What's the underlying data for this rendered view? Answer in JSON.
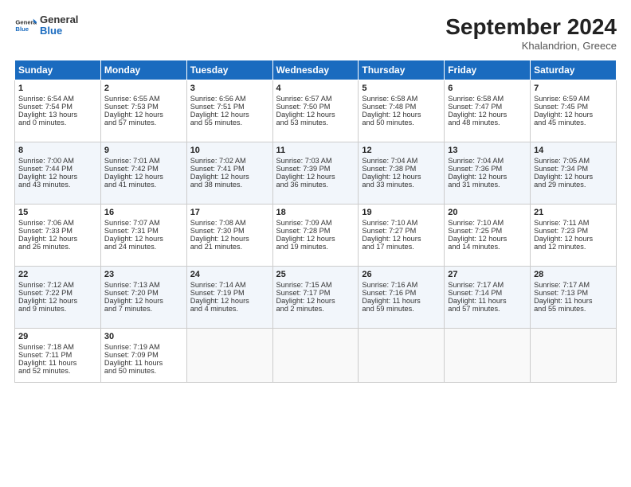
{
  "header": {
    "logo_general": "General",
    "logo_blue": "Blue",
    "month_title": "September 2024",
    "location": "Khalandrion, Greece"
  },
  "weekdays": [
    "Sunday",
    "Monday",
    "Tuesday",
    "Wednesday",
    "Thursday",
    "Friday",
    "Saturday"
  ],
  "rows": [
    [
      {
        "day": "1",
        "lines": [
          "Sunrise: 6:54 AM",
          "Sunset: 7:54 PM",
          "Daylight: 13 hours",
          "and 0 minutes."
        ]
      },
      {
        "day": "2",
        "lines": [
          "Sunrise: 6:55 AM",
          "Sunset: 7:53 PM",
          "Daylight: 12 hours",
          "and 57 minutes."
        ]
      },
      {
        "day": "3",
        "lines": [
          "Sunrise: 6:56 AM",
          "Sunset: 7:51 PM",
          "Daylight: 12 hours",
          "and 55 minutes."
        ]
      },
      {
        "day": "4",
        "lines": [
          "Sunrise: 6:57 AM",
          "Sunset: 7:50 PM",
          "Daylight: 12 hours",
          "and 53 minutes."
        ]
      },
      {
        "day": "5",
        "lines": [
          "Sunrise: 6:58 AM",
          "Sunset: 7:48 PM",
          "Daylight: 12 hours",
          "and 50 minutes."
        ]
      },
      {
        "day": "6",
        "lines": [
          "Sunrise: 6:58 AM",
          "Sunset: 7:47 PM",
          "Daylight: 12 hours",
          "and 48 minutes."
        ]
      },
      {
        "day": "7",
        "lines": [
          "Sunrise: 6:59 AM",
          "Sunset: 7:45 PM",
          "Daylight: 12 hours",
          "and 45 minutes."
        ]
      }
    ],
    [
      {
        "day": "8",
        "lines": [
          "Sunrise: 7:00 AM",
          "Sunset: 7:44 PM",
          "Daylight: 12 hours",
          "and 43 minutes."
        ]
      },
      {
        "day": "9",
        "lines": [
          "Sunrise: 7:01 AM",
          "Sunset: 7:42 PM",
          "Daylight: 12 hours",
          "and 41 minutes."
        ]
      },
      {
        "day": "10",
        "lines": [
          "Sunrise: 7:02 AM",
          "Sunset: 7:41 PM",
          "Daylight: 12 hours",
          "and 38 minutes."
        ]
      },
      {
        "day": "11",
        "lines": [
          "Sunrise: 7:03 AM",
          "Sunset: 7:39 PM",
          "Daylight: 12 hours",
          "and 36 minutes."
        ]
      },
      {
        "day": "12",
        "lines": [
          "Sunrise: 7:04 AM",
          "Sunset: 7:38 PM",
          "Daylight: 12 hours",
          "and 33 minutes."
        ]
      },
      {
        "day": "13",
        "lines": [
          "Sunrise: 7:04 AM",
          "Sunset: 7:36 PM",
          "Daylight: 12 hours",
          "and 31 minutes."
        ]
      },
      {
        "day": "14",
        "lines": [
          "Sunrise: 7:05 AM",
          "Sunset: 7:34 PM",
          "Daylight: 12 hours",
          "and 29 minutes."
        ]
      }
    ],
    [
      {
        "day": "15",
        "lines": [
          "Sunrise: 7:06 AM",
          "Sunset: 7:33 PM",
          "Daylight: 12 hours",
          "and 26 minutes."
        ]
      },
      {
        "day": "16",
        "lines": [
          "Sunrise: 7:07 AM",
          "Sunset: 7:31 PM",
          "Daylight: 12 hours",
          "and 24 minutes."
        ]
      },
      {
        "day": "17",
        "lines": [
          "Sunrise: 7:08 AM",
          "Sunset: 7:30 PM",
          "Daylight: 12 hours",
          "and 21 minutes."
        ]
      },
      {
        "day": "18",
        "lines": [
          "Sunrise: 7:09 AM",
          "Sunset: 7:28 PM",
          "Daylight: 12 hours",
          "and 19 minutes."
        ]
      },
      {
        "day": "19",
        "lines": [
          "Sunrise: 7:10 AM",
          "Sunset: 7:27 PM",
          "Daylight: 12 hours",
          "and 17 minutes."
        ]
      },
      {
        "day": "20",
        "lines": [
          "Sunrise: 7:10 AM",
          "Sunset: 7:25 PM",
          "Daylight: 12 hours",
          "and 14 minutes."
        ]
      },
      {
        "day": "21",
        "lines": [
          "Sunrise: 7:11 AM",
          "Sunset: 7:23 PM",
          "Daylight: 12 hours",
          "and 12 minutes."
        ]
      }
    ],
    [
      {
        "day": "22",
        "lines": [
          "Sunrise: 7:12 AM",
          "Sunset: 7:22 PM",
          "Daylight: 12 hours",
          "and 9 minutes."
        ]
      },
      {
        "day": "23",
        "lines": [
          "Sunrise: 7:13 AM",
          "Sunset: 7:20 PM",
          "Daylight: 12 hours",
          "and 7 minutes."
        ]
      },
      {
        "day": "24",
        "lines": [
          "Sunrise: 7:14 AM",
          "Sunset: 7:19 PM",
          "Daylight: 12 hours",
          "and 4 minutes."
        ]
      },
      {
        "day": "25",
        "lines": [
          "Sunrise: 7:15 AM",
          "Sunset: 7:17 PM",
          "Daylight: 12 hours",
          "and 2 minutes."
        ]
      },
      {
        "day": "26",
        "lines": [
          "Sunrise: 7:16 AM",
          "Sunset: 7:16 PM",
          "Daylight: 11 hours",
          "and 59 minutes."
        ]
      },
      {
        "day": "27",
        "lines": [
          "Sunrise: 7:17 AM",
          "Sunset: 7:14 PM",
          "Daylight: 11 hours",
          "and 57 minutes."
        ]
      },
      {
        "day": "28",
        "lines": [
          "Sunrise: 7:17 AM",
          "Sunset: 7:13 PM",
          "Daylight: 11 hours",
          "and 55 minutes."
        ]
      }
    ],
    [
      {
        "day": "29",
        "lines": [
          "Sunrise: 7:18 AM",
          "Sunset: 7:11 PM",
          "Daylight: 11 hours",
          "and 52 minutes."
        ]
      },
      {
        "day": "30",
        "lines": [
          "Sunrise: 7:19 AM",
          "Sunset: 7:09 PM",
          "Daylight: 11 hours",
          "and 50 minutes."
        ]
      },
      null,
      null,
      null,
      null,
      null
    ]
  ]
}
